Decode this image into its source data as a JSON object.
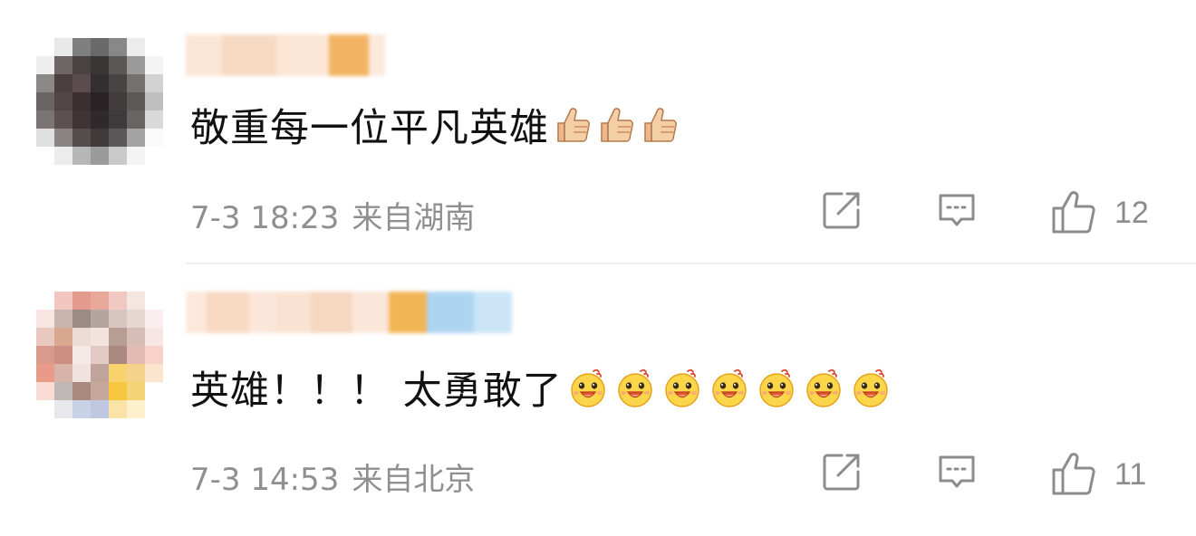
{
  "comments": [
    {
      "text": "敬重每一位平凡英雄",
      "emoji": "thumbs-up",
      "emoji_count": 3,
      "date": "7-3 18:23",
      "location": "来自湖南",
      "likes": "12"
    },
    {
      "text": "英雄！！！ 太勇敢了",
      "emoji": "duck-smile",
      "emoji_count": 7,
      "date": "7-3 14:53",
      "location": "来自北京",
      "likes": "11"
    }
  ],
  "colors": {
    "text": "#111111",
    "meta": "#8f8f8f",
    "icon": "#8c8c8c",
    "divider": "#efefef"
  },
  "icons": [
    "share-icon",
    "comment-icon",
    "like-icon"
  ]
}
